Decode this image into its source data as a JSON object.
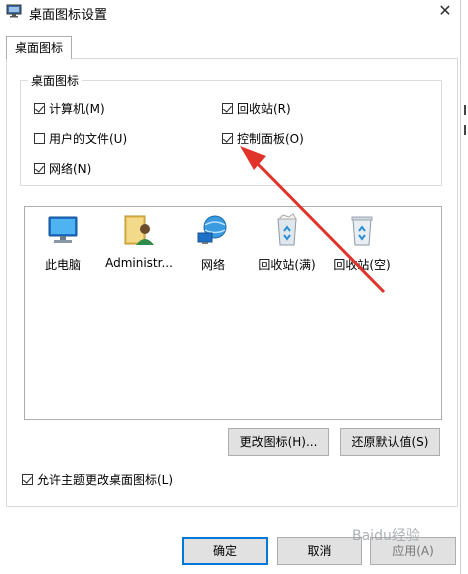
{
  "window": {
    "title": "桌面图标设置",
    "close_glyph": "✕"
  },
  "tab": {
    "label": "桌面图标"
  },
  "group": {
    "label": "桌面图标",
    "checkboxes": [
      {
        "label": "计算机(M)",
        "checked": true
      },
      {
        "label": "回收站(R)",
        "checked": true
      },
      {
        "label": "用户的文件(U)",
        "checked": false
      },
      {
        "label": "控制面板(O)",
        "checked": true
      },
      {
        "label": "网络(N)",
        "checked": true
      }
    ]
  },
  "icons": [
    {
      "label": "此电脑",
      "icon": "computer-icon"
    },
    {
      "label": "Administr...",
      "icon": "user-folder-icon"
    },
    {
      "label": "网络",
      "icon": "network-icon"
    },
    {
      "label": "回收站(满)",
      "icon": "recycle-bin-full-icon"
    },
    {
      "label": "回收站(空)",
      "icon": "recycle-bin-empty-icon"
    }
  ],
  "buttons": {
    "change_icon": "更改图标(H)...",
    "restore_default": "还原默认值(S)",
    "ok": "确定",
    "cancel": "取消",
    "apply": "应用(A)"
  },
  "allow_themes": {
    "label": "允许主题更改桌面图标(L)",
    "checked": true
  },
  "watermark": {
    "text": "Baidu经验"
  },
  "colors": {
    "annotation_arrow": "#e0342a",
    "focus_border": "#0078d7"
  }
}
